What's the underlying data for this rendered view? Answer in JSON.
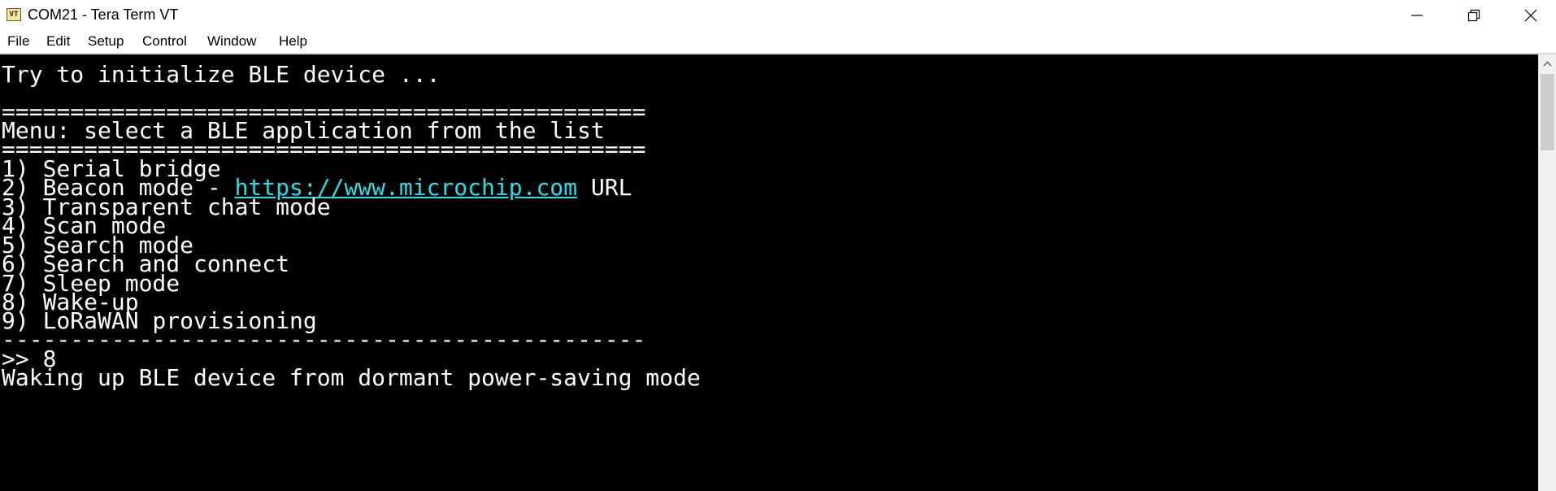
{
  "window": {
    "title": "COM21 - Tera Term VT",
    "icon_label": "VT",
    "controls": [
      "minimize-icon",
      "restore-icon",
      "close-icon"
    ]
  },
  "menu": [
    "File",
    "Edit",
    "Setup",
    "Control",
    "Window",
    "Help"
  ],
  "terminal": {
    "line_init": "Try to initialize BLE device ...",
    "rule_top": "===============================================",
    "menu_header": "Menu: select a BLE application from the list",
    "rule_mid": "===============================================",
    "item1": "1) Serial bridge",
    "item2_prefix": "2) Beacon mode - ",
    "item2_link": "https://www.microchip.com",
    "item2_suffix": " URL",
    "item3": "3) Transparent chat mode",
    "item4": "4) Scan mode",
    "item5": "5) Search mode",
    "item6": "6) Search and connect",
    "item7": "7) Sleep mode",
    "item8": "8) Wake-up",
    "item9": "9) LoRaWAN provisioning",
    "rule_bottom": "-----------------------------------------------",
    "prompt": ">> 8",
    "status": "Waking up BLE device from dormant power-saving mode"
  },
  "colors": {
    "background": "#000000",
    "text": "#ffffff",
    "link": "#25e0e6"
  }
}
